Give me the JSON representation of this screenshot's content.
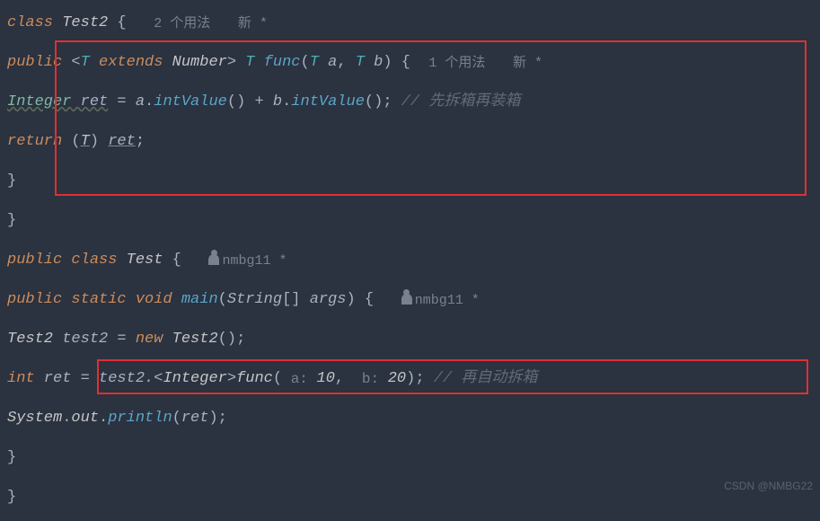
{
  "lines": {
    "l1_class": "class",
    "l1_name": "Test2",
    "l1_brace": " {",
    "l1_usage": "2 个用法",
    "l1_author": "新 *",
    "l2_public": "public",
    "l2_gen_open": " <",
    "l2_t1": "T",
    "l2_extends": " extends ",
    "l2_number": "Number",
    "l2_gen_close": ">",
    "l2_rt": " T ",
    "l2_func": "func",
    "l2_paren_open": "(",
    "l2_p1t": "T ",
    "l2_p1n": "a",
    "l2_comma": ", ",
    "l2_p2t": "T ",
    "l2_p2n": "b",
    "l2_paren_close": ")",
    "l2_brace": " {",
    "l2_usage": "1 个用法",
    "l2_author": "新 *",
    "l3_integer": "Integer",
    "l3_ret": " ret",
    "l3_eq": " = ",
    "l3_a": "a",
    "l3_dot1": ".",
    "l3_m1": "intValue",
    "l3_p1": "()",
    "l3_plus": " + ",
    "l3_b": "b",
    "l3_dot2": ".",
    "l3_m2": "intValue",
    "l3_p2": "();",
    "l3_comment": " // 先拆箱再装箱",
    "l4_return": "return",
    "l4_cast_open": " (",
    "l4_cast_t": "T",
    "l4_cast_close": ") ",
    "l4_ret": "ret",
    "l4_semi": ";",
    "l5_brace": "}",
    "l6_brace": "}",
    "l7_public": "public",
    "l7_class": " class ",
    "l7_name": "Test",
    "l7_brace": " {",
    "l7_author": "nmbg11 *",
    "l8_public": "public",
    "l8_static": " static",
    "l8_void": " void",
    "l8_main": " main",
    "l8_po": "(",
    "l8_string": "String",
    "l8_arr": "[] ",
    "l8_args": "args",
    "l8_pc": ")",
    "l8_brace": " {",
    "l8_author": "nmbg11 *",
    "l9_t2type": "Test2 ",
    "l9_var": "test2",
    "l9_eq": " = ",
    "l9_new": "new",
    "l9_ctor": " Test2",
    "l9_par": "();",
    "l10_int": "int",
    "l10_ret": " ret",
    "l10_eq": " = ",
    "l10_test2": "test2",
    "l10_dot": ".",
    "l10_go": "<",
    "l10_integer": "Integer",
    "l10_gc": ">",
    "l10_func": "func",
    "l10_po": "(",
    "l10_ph1": " a: ",
    "l10_v1": "10",
    "l10_comma": ", ",
    "l10_ph2": " b: ",
    "l10_v2": "20",
    "l10_pc": ");",
    "l10_comment": " // 再自动拆箱",
    "l11_sys": "System",
    "l11_dot1": ".",
    "l11_out": "out",
    "l11_dot2": ".",
    "l11_println": "println",
    "l11_po": "(",
    "l11_arg": "ret",
    "l11_pc": ");",
    "l12_brace": "}",
    "l13_brace": "}"
  },
  "watermark": "CSDN @NMBG22"
}
